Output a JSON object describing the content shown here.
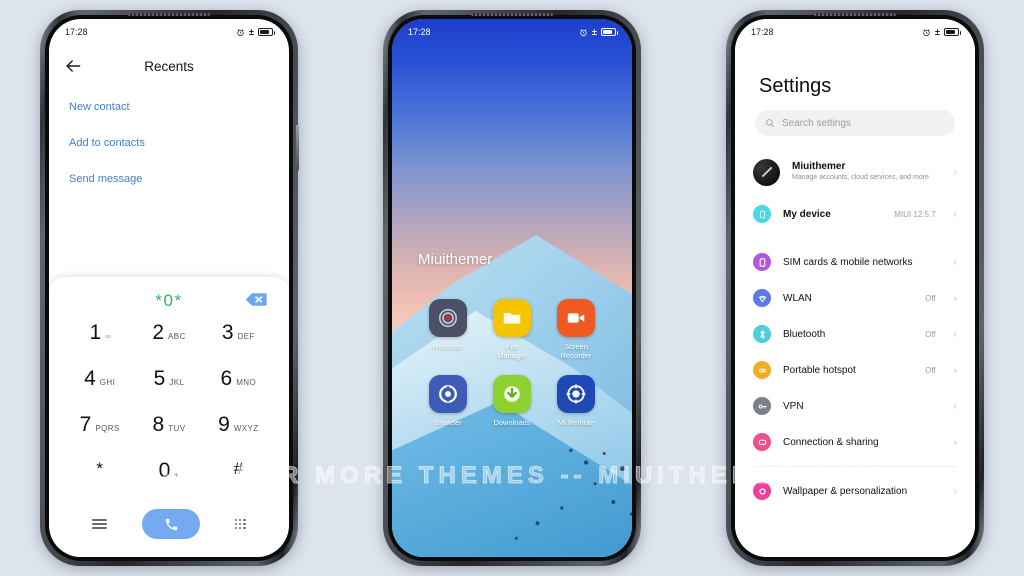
{
  "background_color": "#dde4ed",
  "watermark": "VISIT FOR MORE THEMES -- MIUITHEMER.COM",
  "status_bar": {
    "time": "17:28",
    "alarm_icon": "alarm-clock-icon",
    "charge_icon": "±",
    "battery_icon": "battery-icon"
  },
  "phone1": {
    "name": "dialer-screen",
    "title": "Recents",
    "back_icon": "back-arrow-icon",
    "links": [
      {
        "label": "New contact"
      },
      {
        "label": "Add to contacts"
      },
      {
        "label": "Send message"
      }
    ],
    "dialed_number": "*0*",
    "number_color": "#2cb45f",
    "delete_icon": "backspace-icon",
    "keys": [
      {
        "digit": "1",
        "letters": "",
        "voicemail": "∞"
      },
      {
        "digit": "2",
        "letters": "ABC"
      },
      {
        "digit": "3",
        "letters": "DEF"
      },
      {
        "digit": "4",
        "letters": "GHI"
      },
      {
        "digit": "5",
        "letters": "JKL"
      },
      {
        "digit": "6",
        "letters": "MNO"
      },
      {
        "digit": "7",
        "letters": "PQRS"
      },
      {
        "digit": "8",
        "letters": "TUV"
      },
      {
        "digit": "9",
        "letters": "WXYZ"
      },
      {
        "digit": "*",
        "letters": ""
      },
      {
        "digit": "0",
        "letters": "+"
      },
      {
        "digit": "#",
        "letters": ""
      }
    ],
    "actions": {
      "menu_icon": "hamburger-menu-icon",
      "call_icon": "phone-handset-icon",
      "call_button_color": "#74aaf0",
      "keypad_icon": "dialpad-grid-icon"
    }
  },
  "phone2": {
    "name": "home-screen",
    "wallpaper_label": "Miuithemer",
    "apps": [
      {
        "label": "Recorder",
        "icon": "recorder-icon",
        "bg": "#4b5066"
      },
      {
        "label": "File\nManager",
        "icon": "folder-icon",
        "bg": "#f5c400"
      },
      {
        "label": "Screen\nRecorder",
        "icon": "video-camera-icon",
        "bg": "#ef5a23"
      },
      {
        "label": "Browser",
        "icon": "browser-compass-icon",
        "bg": "#3e5bb5"
      },
      {
        "label": "Downloads",
        "icon": "download-arrow-icon",
        "bg": "#8dd130"
      },
      {
        "label": "Mi Remote",
        "icon": "remote-control-icon",
        "bg": "#1f49b5"
      }
    ]
  },
  "phone3": {
    "name": "settings-screen",
    "title": "Settings",
    "search_placeholder": "Search settings",
    "search_icon": "search-icon",
    "account": {
      "label": "Miuithemer",
      "subtitle": "Manage accounts, cloud services, and more",
      "avatar_icon": "avatar-icon"
    },
    "device": {
      "label": "My device",
      "value": "MIUI 12.5.7",
      "icon": "phone-device-icon",
      "color": "#4ad7e8"
    },
    "items": [
      {
        "label": "SIM cards & mobile networks",
        "value": "",
        "icon": "sim-card-icon",
        "color": "#b357e0"
      },
      {
        "label": "WLAN",
        "value": "Off",
        "icon": "wifi-icon",
        "color": "#5b7ce8"
      },
      {
        "label": "Bluetooth",
        "value": "Off",
        "icon": "bluetooth-icon",
        "color": "#4ad0dd"
      },
      {
        "label": "Portable hotspot",
        "value": "Off",
        "icon": "hotspot-icon",
        "color": "#f0ad26"
      },
      {
        "label": "VPN",
        "value": "",
        "icon": "vpn-key-icon",
        "color": "#7b7f8a"
      },
      {
        "label": "Connection & sharing",
        "value": "",
        "icon": "connection-icon",
        "color": "#ef4e8c"
      }
    ],
    "items_bottom": [
      {
        "label": "Wallpaper & personalization",
        "value": "",
        "icon": "wallpaper-icon",
        "color": "#ef3f9a"
      }
    ]
  }
}
